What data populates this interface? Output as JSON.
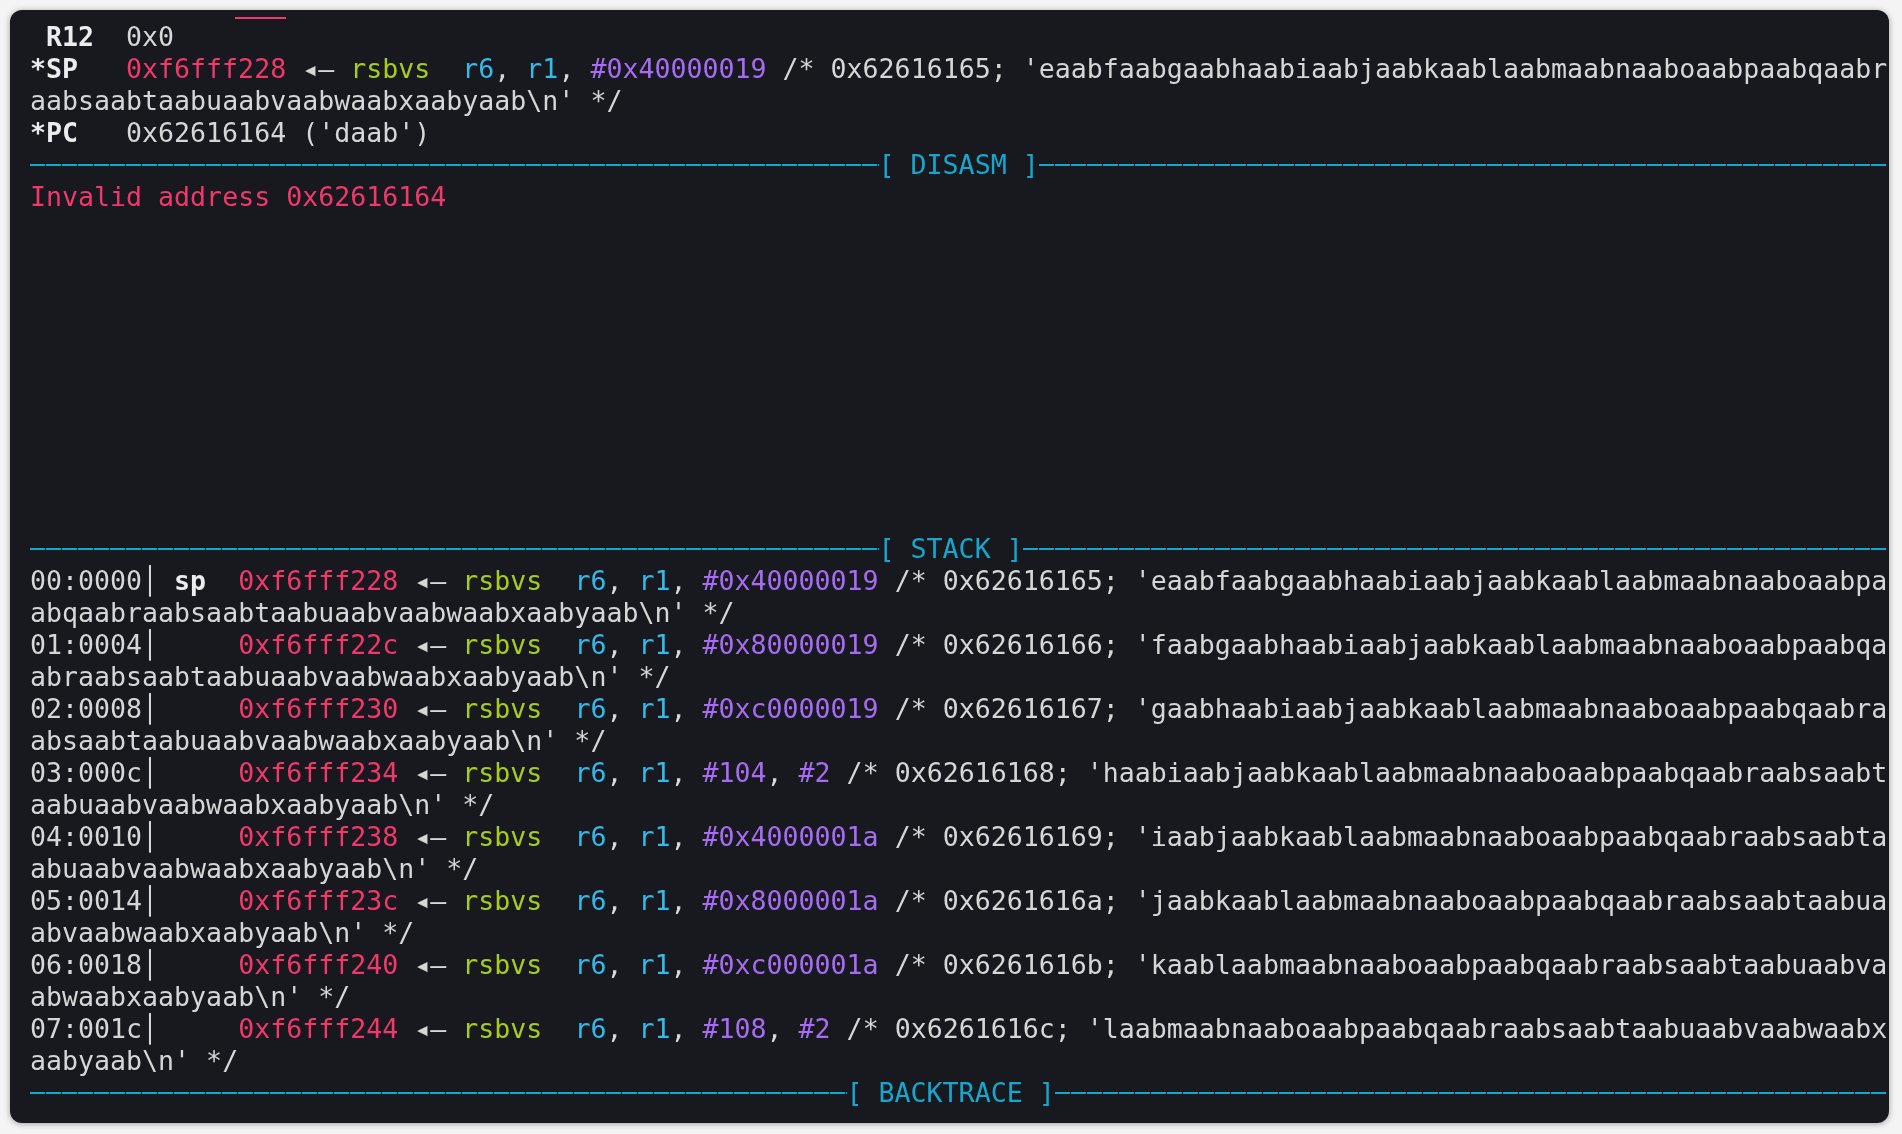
{
  "registers": [
    {
      "name": "R12",
      "value": [
        {
          "kind": "plain",
          "text": "0x0"
        }
      ]
    },
    {
      "marker": "*",
      "name": "SP",
      "value": [
        {
          "kind": "address",
          "text": "0xf6fff228"
        },
        {
          "kind": "plain",
          "text": " ◂— "
        },
        {
          "kind": "mnemonic",
          "text": "rsbvs"
        },
        {
          "kind": "register",
          "text": "r6"
        },
        {
          "kind": "plain",
          "text": ", "
        },
        {
          "kind": "register",
          "text": "r1"
        },
        {
          "kind": "plain",
          "text": ", "
        },
        {
          "kind": "immediate",
          "text": "#0x40000019"
        },
        {
          "kind": "plain",
          "text": " /* 0x62616165; 'eaabfaabgaabhaabiaabjaabkaablaabmaabnaaboaabpaabqaabraabsaabtaabuaabvaabwaabxaabyaab\\n' */"
        }
      ]
    },
    {
      "marker": "*",
      "name": "PC",
      "value": [
        {
          "kind": "plain",
          "text": "0x62616164 ('daab')"
        }
      ]
    }
  ],
  "disasm": {
    "title": "[ DISASM ]",
    "message": "Invalid address 0x62616164"
  },
  "stack": {
    "title": "[ STACK ]",
    "entries": [
      {
        "index": "00:0000│",
        "pointer": "sp",
        "segments": [
          {
            "kind": "address",
            "text": "0xf6fff228"
          },
          {
            "kind": "plain",
            "text": " ◂— "
          },
          {
            "kind": "mnemonic",
            "text": "rsbvs"
          },
          {
            "kind": "register",
            "text": "r6"
          },
          {
            "kind": "plain",
            "text": ", "
          },
          {
            "kind": "register",
            "text": "r1"
          },
          {
            "kind": "plain",
            "text": ", "
          },
          {
            "kind": "immediate",
            "text": "#0x40000019"
          },
          {
            "kind": "plain",
            "text": " /* 0x62616165; 'eaabfaabgaabhaabiaabjaabkaablaabmaabnaaboaabpaabqaabraabsaabtaabuaabvaabwaabxaabyaab\\n' */"
          }
        ]
      },
      {
        "index": "01:0004│",
        "segments": [
          {
            "kind": "address",
            "text": "0xf6fff22c"
          },
          {
            "kind": "plain",
            "text": " ◂— "
          },
          {
            "kind": "mnemonic",
            "text": "rsbvs"
          },
          {
            "kind": "register",
            "text": "r6"
          },
          {
            "kind": "plain",
            "text": ", "
          },
          {
            "kind": "register",
            "text": "r1"
          },
          {
            "kind": "plain",
            "text": ", "
          },
          {
            "kind": "immediate",
            "text": "#0x80000019"
          },
          {
            "kind": "plain",
            "text": " /* 0x62616166; 'faabgaabhaabiaabjaabkaablaabmaabnaaboaabpaabqaabraabsaabtaabuaabvaabwaabxaabyaab\\n' */"
          }
        ]
      },
      {
        "index": "02:0008│",
        "segments": [
          {
            "kind": "address",
            "text": "0xf6fff230"
          },
          {
            "kind": "plain",
            "text": " ◂— "
          },
          {
            "kind": "mnemonic",
            "text": "rsbvs"
          },
          {
            "kind": "register",
            "text": "r6"
          },
          {
            "kind": "plain",
            "text": ", "
          },
          {
            "kind": "register",
            "text": "r1"
          },
          {
            "kind": "plain",
            "text": ", "
          },
          {
            "kind": "immediate",
            "text": "#0xc0000019"
          },
          {
            "kind": "plain",
            "text": " /* 0x62616167; 'gaabhaabiaabjaabkaablaabmaabnaaboaabpaabqaabraabsaabtaabuaabvaabwaabxaabyaab\\n' */"
          }
        ]
      },
      {
        "index": "03:000c│",
        "segments": [
          {
            "kind": "address",
            "text": "0xf6fff234"
          },
          {
            "kind": "plain",
            "text": " ◂— "
          },
          {
            "kind": "mnemonic",
            "text": "rsbvs"
          },
          {
            "kind": "register",
            "text": "r6"
          },
          {
            "kind": "plain",
            "text": ", "
          },
          {
            "kind": "register",
            "text": "r1"
          },
          {
            "kind": "plain",
            "text": ", "
          },
          {
            "kind": "immediate",
            "text": "#104"
          },
          {
            "kind": "plain",
            "text": ", "
          },
          {
            "kind": "immediate",
            "text": "#2"
          },
          {
            "kind": "plain",
            "text": " /* 0x62616168; 'haabiaabjaabkaablaabmaabnaaboaabpaabqaabraabsaabtaabuaabvaabwaabxaabyaab\\n' */"
          }
        ]
      },
      {
        "index": "04:0010│",
        "segments": [
          {
            "kind": "address",
            "text": "0xf6fff238"
          },
          {
            "kind": "plain",
            "text": " ◂— "
          },
          {
            "kind": "mnemonic",
            "text": "rsbvs"
          },
          {
            "kind": "register",
            "text": "r6"
          },
          {
            "kind": "plain",
            "text": ", "
          },
          {
            "kind": "register",
            "text": "r1"
          },
          {
            "kind": "plain",
            "text": ", "
          },
          {
            "kind": "immediate",
            "text": "#0x4000001a"
          },
          {
            "kind": "plain",
            "text": " /* 0x62616169; 'iaabjaabkaablaabmaabnaaboaabpaabqaabraabsaabtaabuaabvaabwaabxaabyaab\\n' */"
          }
        ]
      },
      {
        "index": "05:0014│",
        "segments": [
          {
            "kind": "address",
            "text": "0xf6fff23c"
          },
          {
            "kind": "plain",
            "text": " ◂— "
          },
          {
            "kind": "mnemonic",
            "text": "rsbvs"
          },
          {
            "kind": "register",
            "text": "r6"
          },
          {
            "kind": "plain",
            "text": ", "
          },
          {
            "kind": "register",
            "text": "r1"
          },
          {
            "kind": "plain",
            "text": ", "
          },
          {
            "kind": "immediate",
            "text": "#0x8000001a"
          },
          {
            "kind": "plain",
            "text": " /* 0x6261616a; 'jaabkaablaabmaabnaaboaabpaabqaabraabsaabtaabuaabvaabwaabxaabyaab\\n' */"
          }
        ]
      },
      {
        "index": "06:0018│",
        "segments": [
          {
            "kind": "address",
            "text": "0xf6fff240"
          },
          {
            "kind": "plain",
            "text": " ◂— "
          },
          {
            "kind": "mnemonic",
            "text": "rsbvs"
          },
          {
            "kind": "register",
            "text": "r6"
          },
          {
            "kind": "plain",
            "text": ", "
          },
          {
            "kind": "register",
            "text": "r1"
          },
          {
            "kind": "plain",
            "text": ", "
          },
          {
            "kind": "immediate",
            "text": "#0xc000001a"
          },
          {
            "kind": "plain",
            "text": " /* 0x6261616b; 'kaablaabmaabnaaboaabpaabqaabraabsaabtaabuaabvaabwaabxaabyaab\\n' */"
          }
        ]
      },
      {
        "index": "07:001c│",
        "segments": [
          {
            "kind": "address",
            "text": "0xf6fff244"
          },
          {
            "kind": "plain",
            "text": " ◂— "
          },
          {
            "kind": "mnemonic",
            "text": "rsbvs"
          },
          {
            "kind": "register",
            "text": "r6"
          },
          {
            "kind": "plain",
            "text": ", "
          },
          {
            "kind": "register",
            "text": "r1"
          },
          {
            "kind": "plain",
            "text": ", "
          },
          {
            "kind": "immediate",
            "text": "#108"
          },
          {
            "kind": "plain",
            "text": ", "
          },
          {
            "kind": "immediate",
            "text": "#2"
          },
          {
            "kind": "plain",
            "text": " /* 0x6261616c; 'laabmaabnaaboaabpaabqaabraabsaabtaabuaabvaabwaabxaabyaab\\n' */"
          }
        ]
      }
    ]
  },
  "backtrace": {
    "title": "[ BACKTRACE ]"
  }
}
